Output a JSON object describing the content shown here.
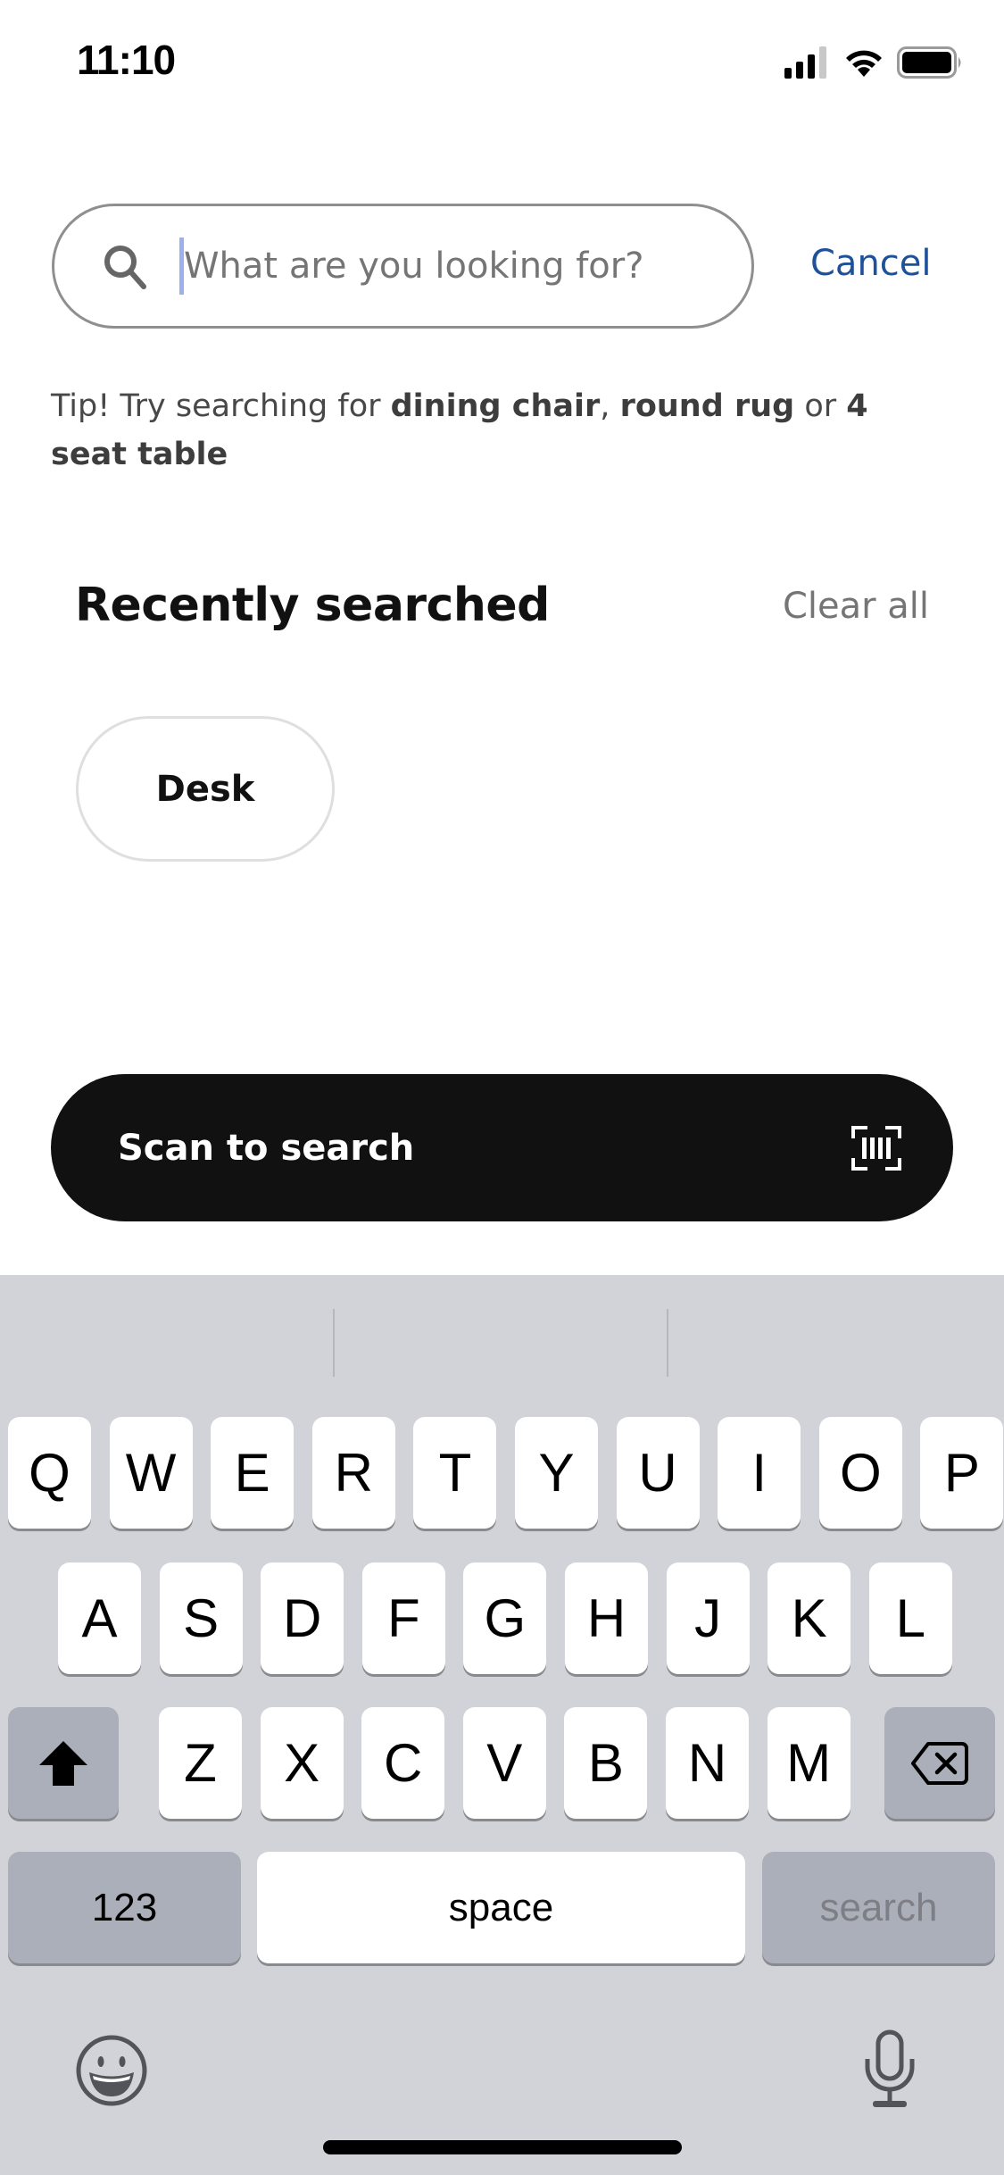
{
  "status_bar": {
    "time": "11:10",
    "icons": [
      "cellular-signal-icon",
      "wifi-icon",
      "battery-icon"
    ]
  },
  "search": {
    "placeholder": "What are you looking for?",
    "value": "",
    "icon": "search-icon",
    "cancel_label": "Cancel"
  },
  "tip": {
    "prefix": "Tip! Try searching for ",
    "suggestions": [
      "dining chair",
      "round rug",
      "4 seat table"
    ],
    "sep1": ", ",
    "sep2": " or "
  },
  "recent": {
    "title": "Recently searched",
    "clear_label": "Clear all",
    "items": [
      {
        "label": "Desk"
      }
    ]
  },
  "scan": {
    "label": "Scan to search",
    "icon": "barcode-scan-icon"
  },
  "keyboard": {
    "row1": [
      "Q",
      "W",
      "E",
      "R",
      "T",
      "Y",
      "U",
      "I",
      "O",
      "P"
    ],
    "row2": [
      "A",
      "S",
      "D",
      "F",
      "G",
      "H",
      "J",
      "K",
      "L"
    ],
    "row3": [
      "Z",
      "X",
      "C",
      "V",
      "B",
      "N",
      "M"
    ],
    "shift_icon": "shift-icon",
    "delete_icon": "backspace-icon",
    "numbers_label": "123",
    "space_label": "space",
    "return_label": "search",
    "emoji_icon": "emoji-icon",
    "dictation_icon": "microphone-icon"
  },
  "colors": {
    "accent_link": "#1d5199",
    "scan_button": "#111111",
    "keyboard_bg": "#d1d3d9"
  }
}
